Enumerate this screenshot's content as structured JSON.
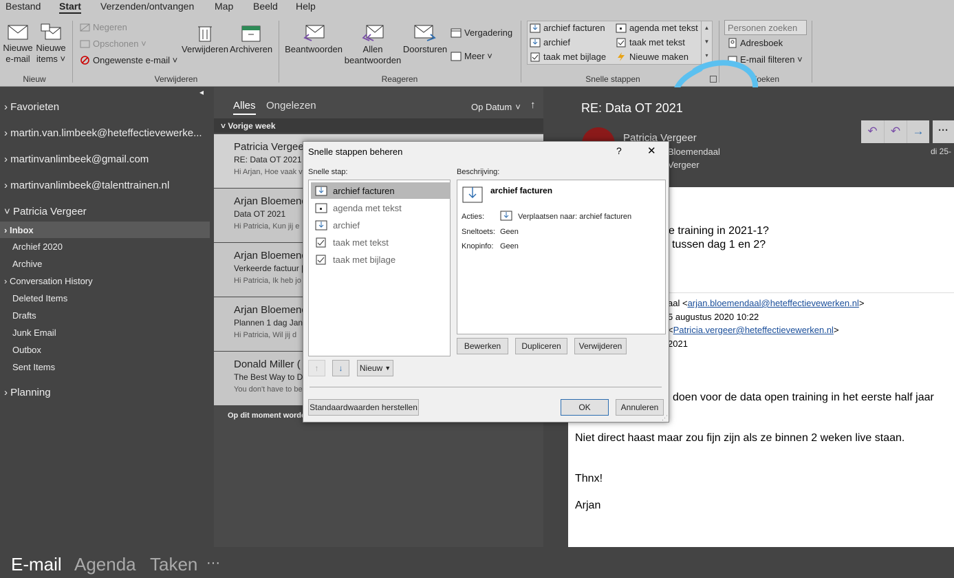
{
  "menu": [
    "Bestand",
    "Start",
    "Verzenden/ontvangen",
    "Map",
    "Beeld",
    "Help"
  ],
  "ribbon": {
    "new_email": "Nieuwe\ne-mail",
    "new_email_l1": "Nieuwe",
    "new_email_l2": "e-mail",
    "new_items_l1": "Nieuwe",
    "new_items_l2": "items ˅",
    "group_nieuw": "Nieuw",
    "ignore": "Negeren",
    "cleanup": "Opschonen ˅",
    "junk": "Ongewenste e-mail ˅",
    "delete": "Verwijderen",
    "archive": "Archiveren",
    "group_verwijderen": "Verwijderen",
    "reply": "Beantwoorden",
    "reply_all_l1": "Allen",
    "reply_all_l2": "beantwoorden",
    "forward": "Doorsturen",
    "meeting": "Vergadering",
    "more": "Meer ˅",
    "group_reageren": "Reageren",
    "qs": [
      "archief facturen",
      "agenda met tekst",
      "archief",
      "taak met tekst",
      "taak met bijlage",
      "Nieuwe maken"
    ],
    "group_snelle": "Snelle stappen",
    "search_placeholder": "Personen zoeken",
    "addressbook": "Adresboek",
    "filter": "E-mail filteren ˅",
    "group_zoeken": "Zoeken"
  },
  "nav": {
    "favorites": "Favorieten",
    "accounts": [
      "martin.van.limbeek@heteffectievewerke...",
      "martinvanlimbeek@gmail.com",
      "martinvanlimbeek@talenttrainen.nl",
      "Patricia Vergeer"
    ],
    "folders": [
      "Inbox",
      "Archief 2020",
      "Archive",
      "Conversation History",
      "Deleted Items",
      "Drafts",
      "Junk Email",
      "Outbox",
      "Sent Items"
    ],
    "planning": "Planning"
  },
  "list": {
    "tab_all": "Alles",
    "tab_unread": "Ongelezen",
    "sort": "Op Datum",
    "group_header": "Vorige week",
    "items": [
      {
        "sender": "Patricia Vergeer",
        "subject": "RE: Data OT 2021",
        "preview": "Hi Arjan,  Hoe vaak v"
      },
      {
        "sender": "Arjan Bloemendaal",
        "subject": "Data OT 2021",
        "preview": "Hi Patricia,  Kun jij e"
      },
      {
        "sender": "Arjan Bloemendaal",
        "subject": "Verkeerde factuur | K",
        "preview": "Hi Patricia,  Ik heb jo"
      },
      {
        "sender": "Arjan Bloemendaal",
        "subject": "Plannen 1 dag Janse",
        "preview": "Hi Patricia,  Wil jij d"
      },
      {
        "sender": "Donald Miller (",
        "subject": "The Best Way to Diff",
        "preview": "You don't have to be"
      }
    ],
    "footer": "Op dit moment worde"
  },
  "reading": {
    "subject": "RE: Data OT 2021",
    "from": "Patricia Vergeer",
    "to_line": "Bloemendaal",
    "cc_line": "Vergeer",
    "date": "di 25-",
    "body_q1": "ze training in 2021-1?",
    "body_q2": "tussen dag 1 en 2?",
    "hdr_from_pre": "aal <",
    "hdr_from_link": "arjan.bloemendaal@heteffectievewerken.nl",
    "hdr_from_post": ">",
    "hdr_date": "5 augustus 2020 10:22",
    "hdr_to_pre": "<",
    "hdr_to_link": "Patricia.vergeer@heteffectievewerken.nl",
    "hdr_to_post": ">",
    "hdr_subject": "2021",
    "body_p1": "l doen voor de data open training in het eerste half jaar",
    "body_p2": "Niet direct haast maar zou fijn zijn als ze binnen 2 weken live staan.",
    "body_p3": "Thnx!",
    "body_p4": "Arjan"
  },
  "bottom": {
    "mail": "E-mail",
    "agenda": "Agenda",
    "tasks": "Taken",
    "more": "···"
  },
  "dialog": {
    "title": "Snelle stappen beheren",
    "help": "?",
    "close": "✕",
    "list_label": "Snelle stap:",
    "desc_label": "Beschrijving:",
    "steps": [
      "archief facturen",
      "agenda met tekst",
      "archief",
      "taak met tekst",
      "taak met bijlage"
    ],
    "desc_title": "archief facturen",
    "actions_label": "Acties:",
    "actions_value": "Verplaatsen naar: archief facturen",
    "shortcut_label": "Sneltoets:",
    "shortcut_value": "Geen",
    "tooltip_label": "Knopinfo:",
    "tooltip_value": "Geen",
    "edit": "Bewerken",
    "duplicate": "Dupliceren",
    "delete": "Verwijderen",
    "new": "Nieuw",
    "reset": "Standaardwaarden herstellen",
    "ok": "OK",
    "cancel": "Annuleren"
  },
  "colors": {
    "accent": "#2b5797",
    "highlight_circle": "#5bc0f0",
    "link": "#1a4e9a"
  }
}
